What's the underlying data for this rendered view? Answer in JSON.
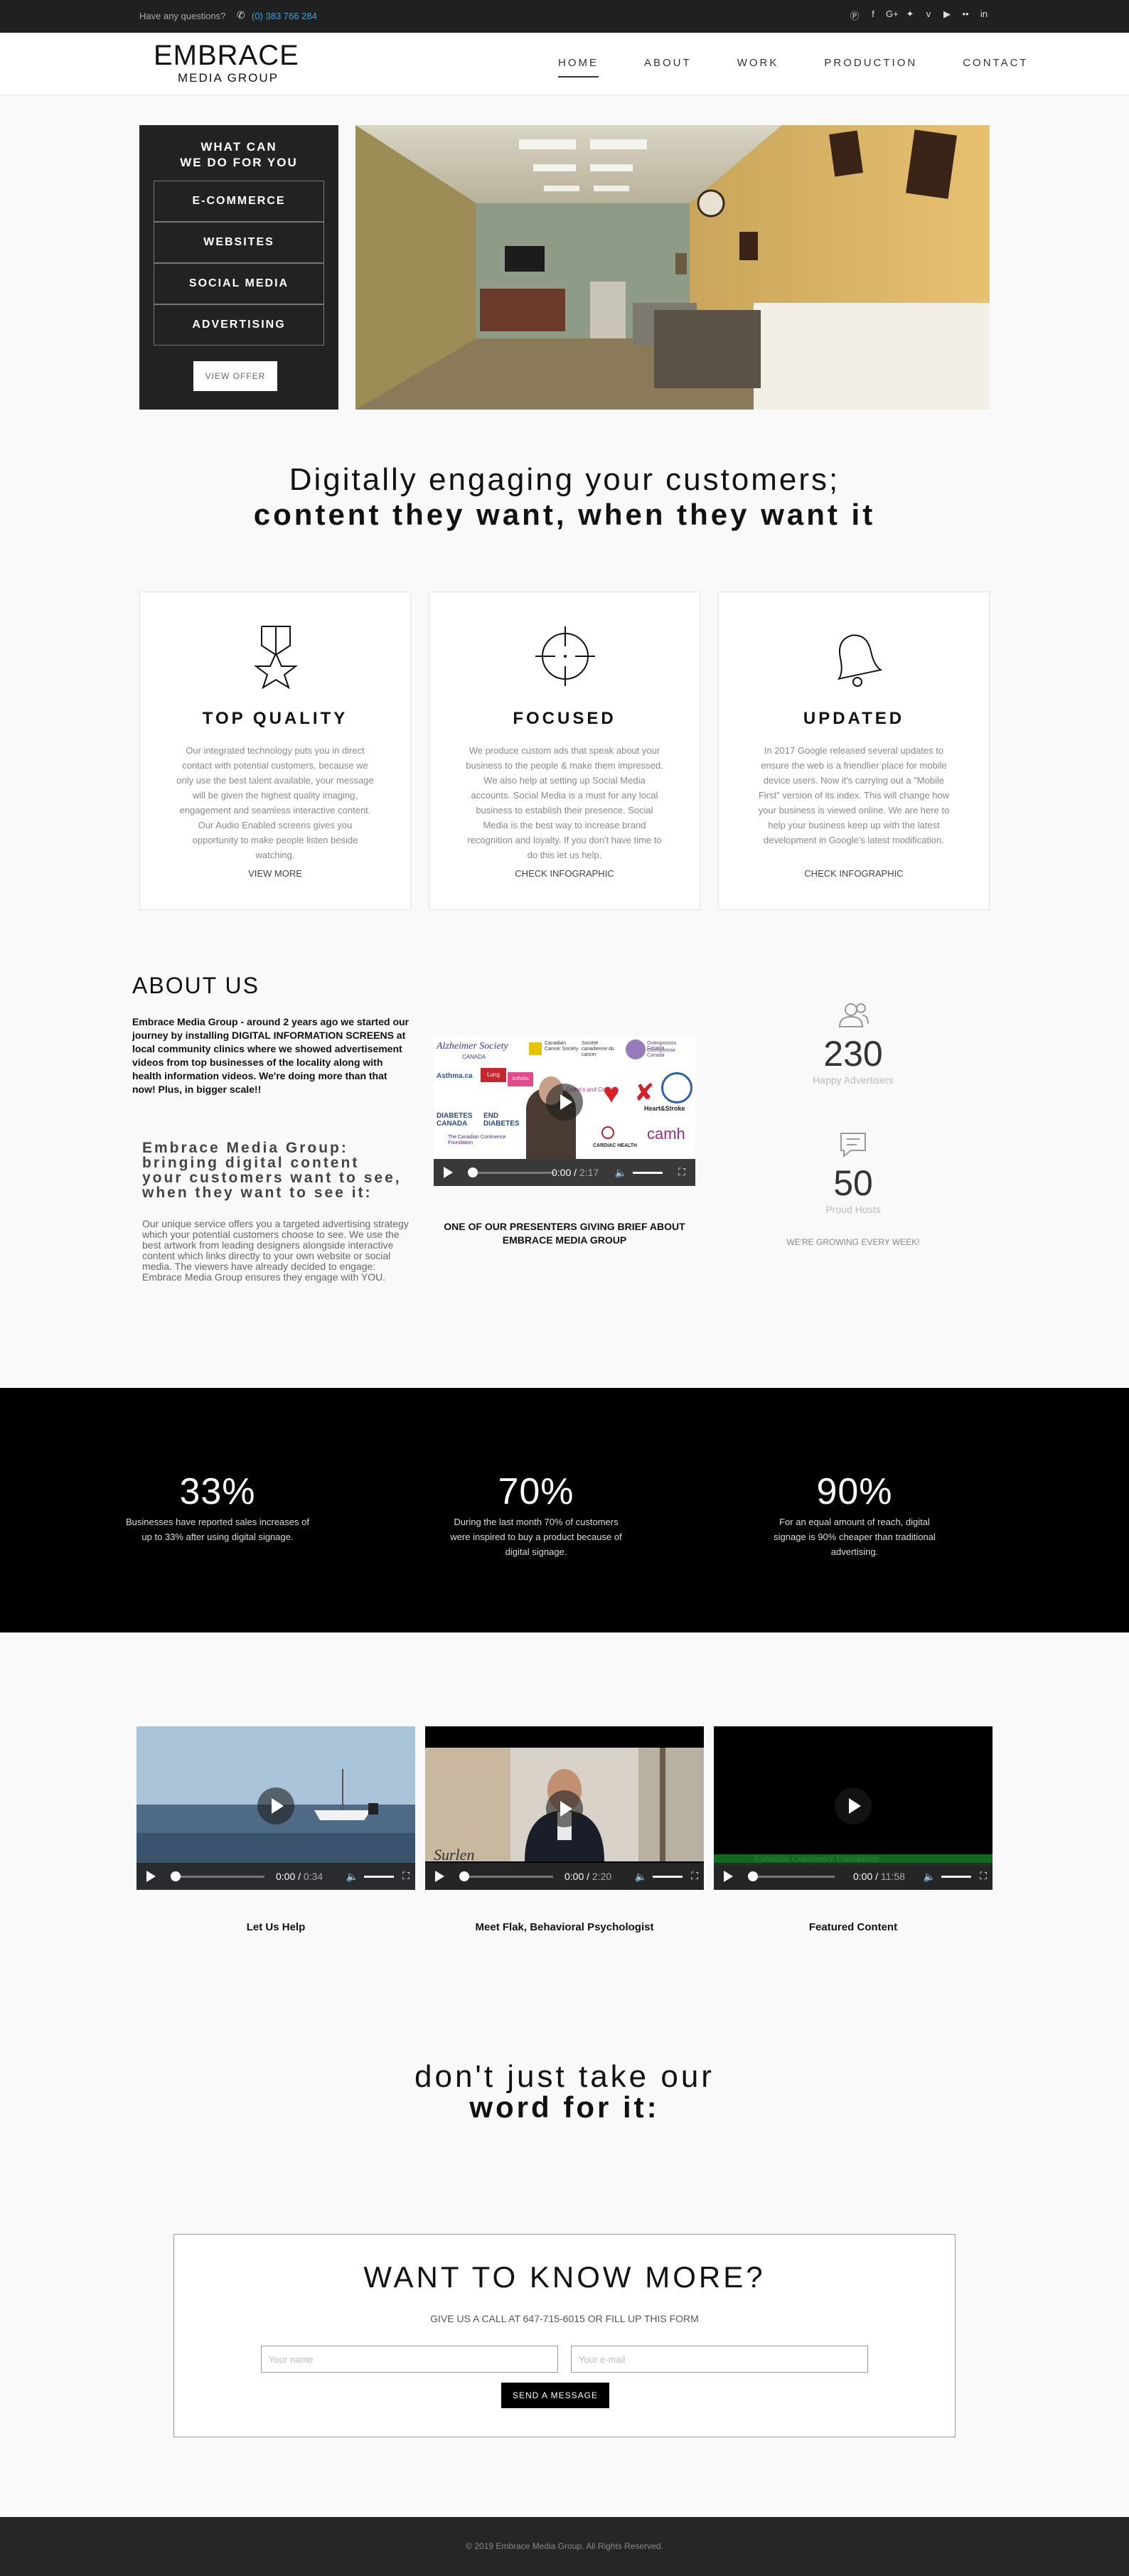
{
  "topbar": {
    "question": "Have any questions?",
    "phone": "(0) 383 766 284",
    "social_icons": [
      "skype-icon",
      "facebook-icon",
      "google-plus-icon",
      "twitter-icon",
      "vimeo-icon",
      "youtube-icon",
      "flickr-icon",
      "linkedin-icon"
    ]
  },
  "logo": {
    "line1": "EMBRACE",
    "line2": "MEDIA GROUP"
  },
  "nav": [
    {
      "label": "HOME",
      "active": true
    },
    {
      "label": "ABOUT"
    },
    {
      "label": "WORK"
    },
    {
      "label": "PRODUCTION"
    },
    {
      "label": "CONTACT"
    }
  ],
  "offer": {
    "title_line1": "WHAT CAN",
    "title_line2": "WE DO FOR YOU",
    "items": [
      "E-COMMERCE",
      "WEBSITES",
      "SOCIAL MEDIA",
      "ADVERTISING"
    ],
    "button": "VIEW OFFER"
  },
  "headline": {
    "line1": "Digitally engaging your customers;",
    "line2": "content they want, when they want it"
  },
  "features": [
    {
      "title": "TOP QUALITY",
      "icon": "medal-star-icon",
      "text": "Our integrated technology puts you in direct contact with potential customers, because we only use the best talent available, your message will be given the highest quality imaging, engagement and seamless interactive content. Our Audio Enabled screens gives you opportunity to make people listen beside watching.",
      "link": "VIEW MORE"
    },
    {
      "title": "FOCUSED",
      "icon": "crosshair-icon",
      "text": "We produce custom ads that speak about your business to the people & make them impressed. We also help at setting up Social Media accounts. Social Media is a must for any local business to establish their presence. Social Media is the best way to increase brand recognition and loyalty. If you don't have time to do this let us help.",
      "link": "CHECK INFOGRAPHIC"
    },
    {
      "title": "UPDATED",
      "icon": "bell-icon",
      "text": "In 2017 Google released several updates to ensure the web is a friendlier place for mobile device users. Now it's carrying out a \"Mobile First\" version of its index. This will change how your business is viewed online. We are here to help your business keep up with the latest development in Google's latest modification.",
      "link": "CHECK INFOGRAPHIC"
    }
  ],
  "about": {
    "heading": "ABOUT US",
    "intro": "Embrace Media Group - around 2 years ago we started our journey by installing DIGITAL INFORMATION SCREENS at local community clinics where we showed advertisement videos from top businesses of the locality along with health information videos. We're doing more than that now! Plus, in bigger scale!!",
    "subheading": "Embrace Media Group: bringing digital content your customers want to see, when they want to see it:",
    "body": "Our unique service offers you a targeted advertising strategy which your potential customers choose to see. We use the best artwork from leading designers alongside interactive content which links directly to your own website or social media. The viewers have already decided to engage: Embrace Media Group ensures they engage with YOU.",
    "video": {
      "time": "0:00",
      "duration": "2:17",
      "caption": "ONE OF OUR PRESENTERS GIVING BRIEF ABOUT EMBRACE MEDIA GROUP",
      "logos": [
        "Alzheimer Society",
        "CANADA",
        "Canadian Cancer Society",
        "Société canadienne du cancer",
        "Osteoporosis Canada",
        "Ostéoporose Canada",
        "Asthma.ca",
        "Lung",
        "Arthritis",
        "Crohn's and Colitis",
        "Heart&Stroke",
        "DIABETES CANADA",
        "END DIABETES",
        "The Canadian Continence Foundation",
        "CARDIAC HEALTH",
        "camh"
      ]
    },
    "stats": [
      {
        "number": "230",
        "label": "Happy Advertisers",
        "icon": "users-icon"
      },
      {
        "number": "50",
        "label": "Proud Hosts",
        "icon": "chat-icon"
      }
    ],
    "growing": "WE'RE GROWING EVERY WEEK!"
  },
  "percentages": [
    {
      "value": "33%",
      "text": "Businesses have reported sales increases of up to 33% after using digital signage."
    },
    {
      "value": "70%",
      "text": "During the last month 70% of customers were inspired to buy a product because of digital signage."
    },
    {
      "value": "90%",
      "text": "For an equal amount of reach, digital signage is 90% cheaper than traditional advertising."
    }
  ],
  "videos": [
    {
      "caption": "Let Us Help",
      "time": "0:00",
      "duration": "0:34"
    },
    {
      "caption": "Meet Flak, Behavioral Psychologist",
      "time": "0:00",
      "duration": "2:20",
      "overlay": "Surlen"
    },
    {
      "caption": "Featured Content",
      "time": "0:00",
      "duration": "11:58",
      "overlay": "Canadian Continence Foundation"
    }
  ],
  "testimonial": {
    "line1": "don't just take our",
    "line2": "word for it:"
  },
  "contact": {
    "title": "WANT TO KNOW MORE?",
    "subtitle": "GIVE US A CALL AT 647-715-6015 OR FILL UP THIS FORM",
    "name_placeholder": "Your name",
    "email_placeholder": "Your e-mail",
    "button": "SEND A MESSAGE"
  },
  "footer": {
    "text": "© 2019 Embrace Media Group. All Rights Reserved."
  }
}
